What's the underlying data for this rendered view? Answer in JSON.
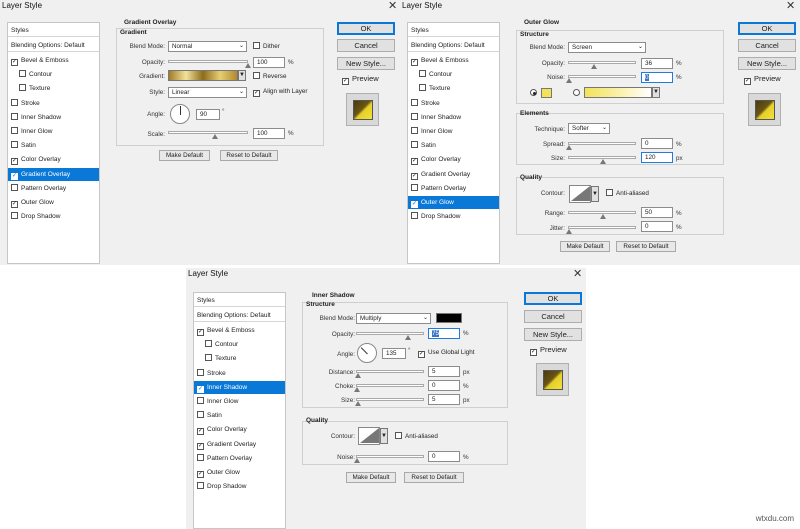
{
  "common": {
    "title": "Layer Style",
    "close": "✕",
    "ok": "OK",
    "cancel": "Cancel",
    "new_style": "New Style...",
    "preview": "Preview",
    "make_default": "Make Default",
    "reset_default": "Reset to Default",
    "styles_header": "Styles",
    "blending_options": "Blending Options: Default"
  },
  "style_list": [
    {
      "label": "Bevel & Emboss",
      "checkbox": true
    },
    {
      "label": "Contour",
      "checkbox": true,
      "sub": true
    },
    {
      "label": "Texture",
      "checkbox": true,
      "sub": true
    },
    {
      "label": "Stroke",
      "checkbox": true
    },
    {
      "label": "Inner Shadow",
      "checkbox": true
    },
    {
      "label": "Inner Glow",
      "checkbox": true
    },
    {
      "label": "Satin",
      "checkbox": true
    },
    {
      "label": "Color Overlay",
      "checkbox": true
    },
    {
      "label": "Gradient Overlay",
      "checkbox": true
    },
    {
      "label": "Pattern Overlay",
      "checkbox": true
    },
    {
      "label": "Outer Glow",
      "checkbox": true
    },
    {
      "label": "Drop Shadow",
      "checkbox": true
    }
  ],
  "dialog1": {
    "checked": [
      true,
      false,
      false,
      false,
      false,
      false,
      false,
      true,
      true,
      false,
      true,
      false
    ],
    "selected_index": 8,
    "section_title": "Gradient Overlay",
    "group_title": "Gradient",
    "blend_mode_label": "Blend Mode:",
    "blend_mode": "Normal",
    "dither_label": "Dither",
    "opacity_label": "Opacity:",
    "opacity": "100",
    "gradient_label": "Gradient:",
    "reverse_label": "Reverse",
    "style_label": "Style:",
    "style": "Linear",
    "align_label": "Align with Layer",
    "angle_label": "Angle:",
    "angle": "90",
    "degree": "°",
    "scale_label": "Scale:",
    "scale": "100",
    "pct": "%"
  },
  "dialog2": {
    "checked": [
      true,
      false,
      false,
      false,
      false,
      false,
      false,
      true,
      true,
      false,
      true,
      false
    ],
    "selected_index": 10,
    "section_title": "Outer Glow",
    "structure_title": "Structure",
    "blend_mode_label": "Blend Mode:",
    "blend_mode": "Screen",
    "opacity_label": "Opacity:",
    "opacity": "36",
    "noise_label": "Noise:",
    "noise": "0",
    "elements_title": "Elements",
    "technique_label": "Technique:",
    "technique": "Softer",
    "spread_label": "Spread:",
    "spread": "0",
    "size_label": "Size:",
    "size": "120",
    "quality_title": "Quality",
    "contour_label": "Contour:",
    "anti_aliased_label": "Anti-aliased",
    "range_label": "Range:",
    "range": "50",
    "jitter_label": "Jitter:",
    "jitter": "0",
    "pct": "%",
    "px": "px",
    "glow_color": "#f2e35a"
  },
  "dialog3": {
    "checked": [
      true,
      false,
      false,
      false,
      true,
      false,
      false,
      true,
      true,
      false,
      true,
      false
    ],
    "selected_index": 4,
    "section_title": "Inner Shadow",
    "structure_title": "Structure",
    "blend_mode_label": "Blend Mode:",
    "blend_mode": "Multiply",
    "shadow_color": "#000000",
    "opacity_label": "Opacity:",
    "opacity": "75",
    "angle_label": "Angle:",
    "angle": "135",
    "degree": "°",
    "global_light_label": "Use Global Light",
    "distance_label": "Distance:",
    "distance": "5",
    "choke_label": "Choke:",
    "choke": "0",
    "size_label": "Size:",
    "size": "5",
    "quality_title": "Quality",
    "contour_label": "Contour:",
    "anti_aliased_label": "Anti-aliased",
    "noise_label": "Noise:",
    "noise": "0",
    "pct": "%",
    "px": "px"
  },
  "watermark": "wtxdu.com"
}
